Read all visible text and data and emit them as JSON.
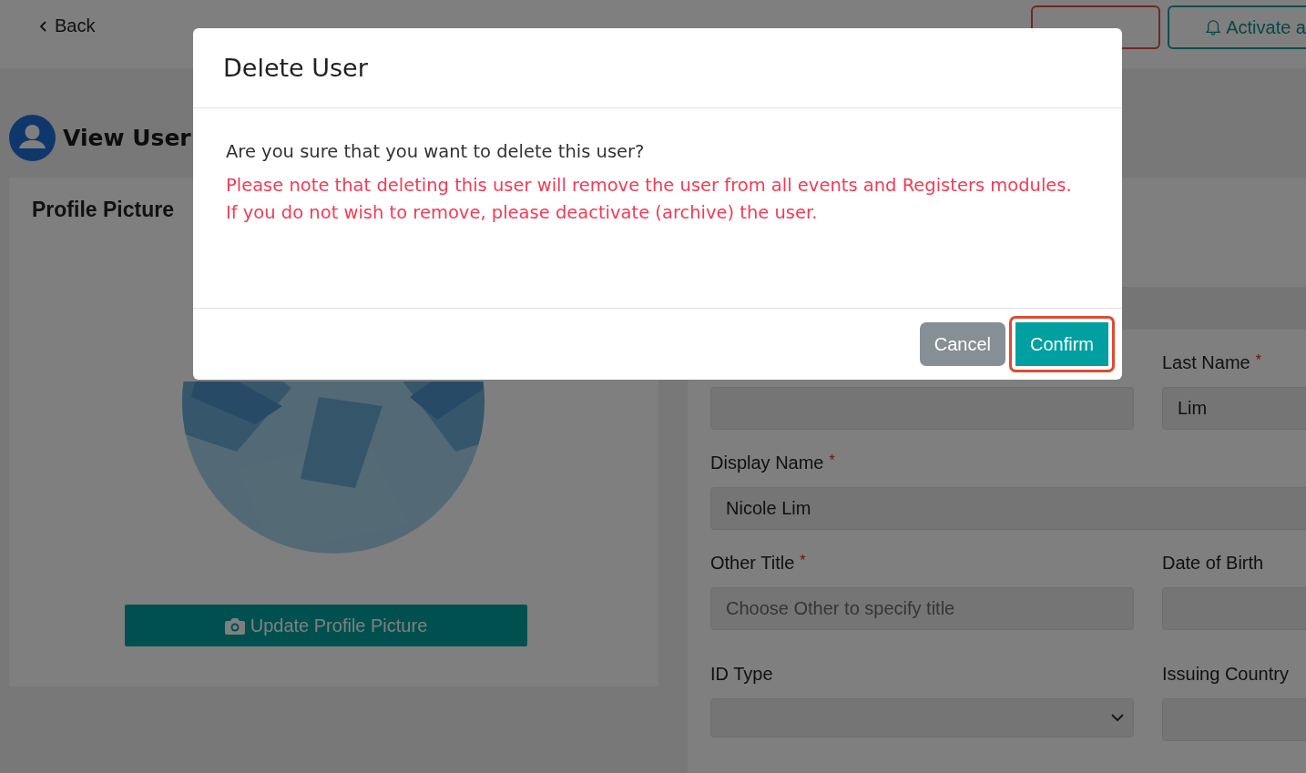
{
  "top_bar": {
    "back": "Back",
    "actions": [
      {
        "kind": "danger"
      },
      {
        "label": "Activate a",
        "kind": "activate"
      }
    ]
  },
  "page_title": "View User",
  "profile_card": {
    "title": "Profile Picture",
    "button": "Update Profile Picture"
  },
  "form": {
    "rows": [
      [
        {
          "kind": "text"
        },
        {
          "label": "Last Name",
          "required_mark": "*",
          "kind": "text",
          "value": "Lim"
        }
      ],
      [
        {
          "label": "Display Name",
          "required_mark": "*",
          "kind": "text",
          "value": "Nicole Lim"
        }
      ],
      [
        {
          "label": "Other Title",
          "required_mark": "*",
          "kind": "text",
          "placeholder": "Choose Other to specify title"
        },
        {
          "label": "Date of Birth",
          "kind": "text"
        }
      ],
      [
        {
          "label": "ID Type",
          "kind": "select"
        },
        {
          "label": "Issuing Country",
          "kind": "text"
        }
      ]
    ]
  },
  "dialog": {
    "title": "Delete User",
    "question": "Are you sure that you want to delete this user?",
    "warnings": [
      "Please note that deleting this user will remove the user from all events and Registers modules.",
      "If you do not wish to remove, please deactivate (archive) the user."
    ],
    "buttons": [
      {
        "label": "Cancel",
        "kind": "secondary",
        "focused": false
      },
      {
        "label": "Confirm",
        "kind": "primary",
        "focused": true
      }
    ]
  }
}
